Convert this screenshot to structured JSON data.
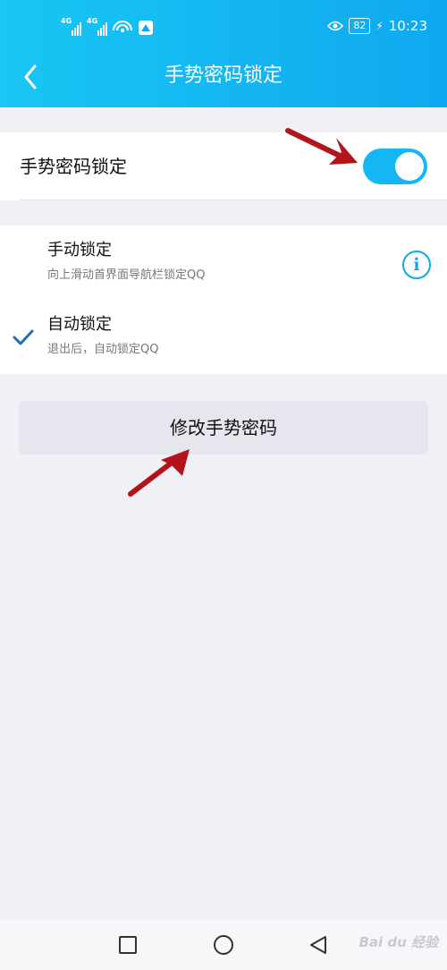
{
  "status_bar": {
    "network_1": "4G",
    "network_2": "4G",
    "battery": "82",
    "time": "10:23"
  },
  "header": {
    "title": "手势密码锁定",
    "back_icon": "chevron-left-icon"
  },
  "gesture_lock": {
    "label": "手势密码锁定",
    "enabled": true
  },
  "options": [
    {
      "title": "手动锁定",
      "subtitle": "向上滑动首界面导航栏锁定QQ",
      "selected": false
    },
    {
      "title": "自动锁定",
      "subtitle": "退出后，自动锁定QQ",
      "selected": true
    }
  ],
  "info_icon_glyph": "i",
  "change_button": {
    "label": "修改手势密码"
  },
  "bottom_nav": {
    "recent_icon": "square-icon",
    "home_icon": "circle-icon",
    "back_icon": "triangle-back-icon"
  },
  "watermark": "Bai du 经验",
  "colors": {
    "accent": "#14b6f3",
    "header_start": "#19c6f4",
    "header_end": "#0fa8ef",
    "check": "#1f6fbf",
    "annotation_arrow": "#b3141a"
  }
}
